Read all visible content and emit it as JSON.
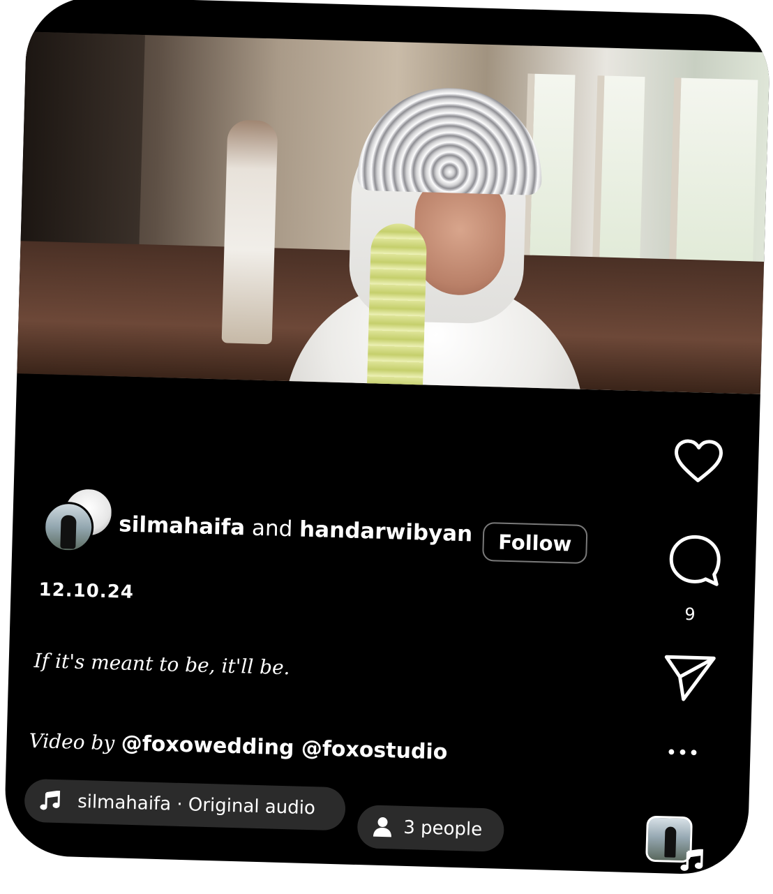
{
  "post": {
    "usernames": {
      "first": "silmahaifa",
      "connector": "and",
      "second": "handarwibyan"
    },
    "follow_label": "Follow",
    "date": "12.10.24",
    "caption": "If it's meant to be, it'll be.",
    "credit": {
      "label": "Video by",
      "tags": "@foxowedding @foxostudio"
    }
  },
  "actions": {
    "like_icon": "heart-icon",
    "comment_icon": "comment-icon",
    "comment_count": "9",
    "share_icon": "send-icon",
    "more_icon": "more-icon",
    "more_label": "•••"
  },
  "audio": {
    "label": "silmahaifa · Original audio",
    "icon": "music-note-icon"
  },
  "people": {
    "label": "3 people",
    "icon": "person-icon"
  },
  "colors": {
    "background": "#000000",
    "text": "#ffffff",
    "pill_bg": "#2b2b2b",
    "follow_border": "#7a7a7a"
  }
}
